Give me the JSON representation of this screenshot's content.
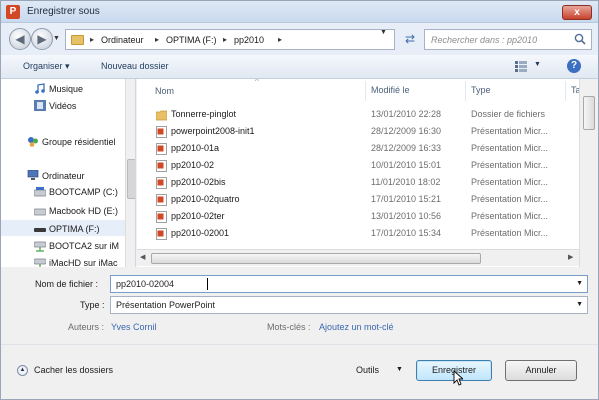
{
  "window": {
    "title": "Enregistrer sous",
    "app_icon": "powerpoint-icon",
    "close_label": "x"
  },
  "nav": {
    "back_icon": "back-arrow-icon",
    "forward_icon": "forward-arrow-icon",
    "breadcrumb": [
      "Ordinateur",
      "OPTIMA (F:)",
      "pp2010"
    ],
    "search_placeholder": "Rechercher dans : pp2010"
  },
  "toolbar": {
    "organize": "Organiser",
    "new_folder": "Nouveau dossier",
    "help": "?"
  },
  "sidebar": {
    "items": [
      {
        "label": "Musique",
        "icon": "music-icon"
      },
      {
        "label": "Vidéos",
        "icon": "video-icon"
      },
      {
        "label": "Groupe résidentiel",
        "icon": "homegroup-icon"
      },
      {
        "label": "Ordinateur",
        "icon": "computer-icon"
      },
      {
        "label": "BOOTCAMP (C:)",
        "icon": "drive-icon"
      },
      {
        "label": "Macbook HD (E:)",
        "icon": "drive-icon"
      },
      {
        "label": "OPTIMA (F:)",
        "icon": "drive-icon",
        "selected": true
      },
      {
        "label": "BOOTCA2 sur iM",
        "icon": "network-drive-icon"
      },
      {
        "label": "iMacHD sur iMac",
        "icon": "network-drive-icon"
      }
    ]
  },
  "files": {
    "columns": [
      "Nom",
      "Modifié le",
      "Type",
      "Ta"
    ],
    "rows": [
      {
        "name": "Tonnerre-pinglot",
        "date": "13/01/2010 22:28",
        "type": "Dossier de fichiers",
        "icon": "folder-icon"
      },
      {
        "name": "powerpoint2008-init1",
        "date": "28/12/2009 16:30",
        "type": "Présentation Micr...",
        "icon": "pptx-file-icon"
      },
      {
        "name": "pp2010-01a",
        "date": "28/12/2009 16:33",
        "type": "Présentation Micr...",
        "icon": "pptx-file-icon"
      },
      {
        "name": "pp2010-02",
        "date": "10/01/2010 15:01",
        "type": "Présentation Micr...",
        "icon": "pptx-file-icon"
      },
      {
        "name": "pp2010-02bis",
        "date": "11/01/2010 18:02",
        "type": "Présentation Micr...",
        "icon": "pptx-file-icon"
      },
      {
        "name": "pp2010-02quatro",
        "date": "17/01/2010 15:21",
        "type": "Présentation Micr...",
        "icon": "pptx-file-icon"
      },
      {
        "name": "pp2010-02ter",
        "date": "13/01/2010 10:56",
        "type": "Présentation Micr...",
        "icon": "pptx-file-icon"
      },
      {
        "name": "pp2010-02001",
        "date": "17/01/2010 15:34",
        "type": "Présentation Micr...",
        "icon": "pptx-file-icon"
      }
    ]
  },
  "form": {
    "filename_label": "Nom de fichier :",
    "filename_value": "pp2010-02004",
    "type_label": "Type :",
    "type_value": "Présentation PowerPoint",
    "authors_label": "Auteurs :",
    "authors_value": "Yves Cornil",
    "keywords_label": "Mots-clés :",
    "keywords_value": "Ajoutez un mot-clé"
  },
  "footer": {
    "hide_folders": "Cacher les dossiers",
    "tools": "Outils",
    "save": "Enregistrer",
    "cancel": "Annuler"
  }
}
